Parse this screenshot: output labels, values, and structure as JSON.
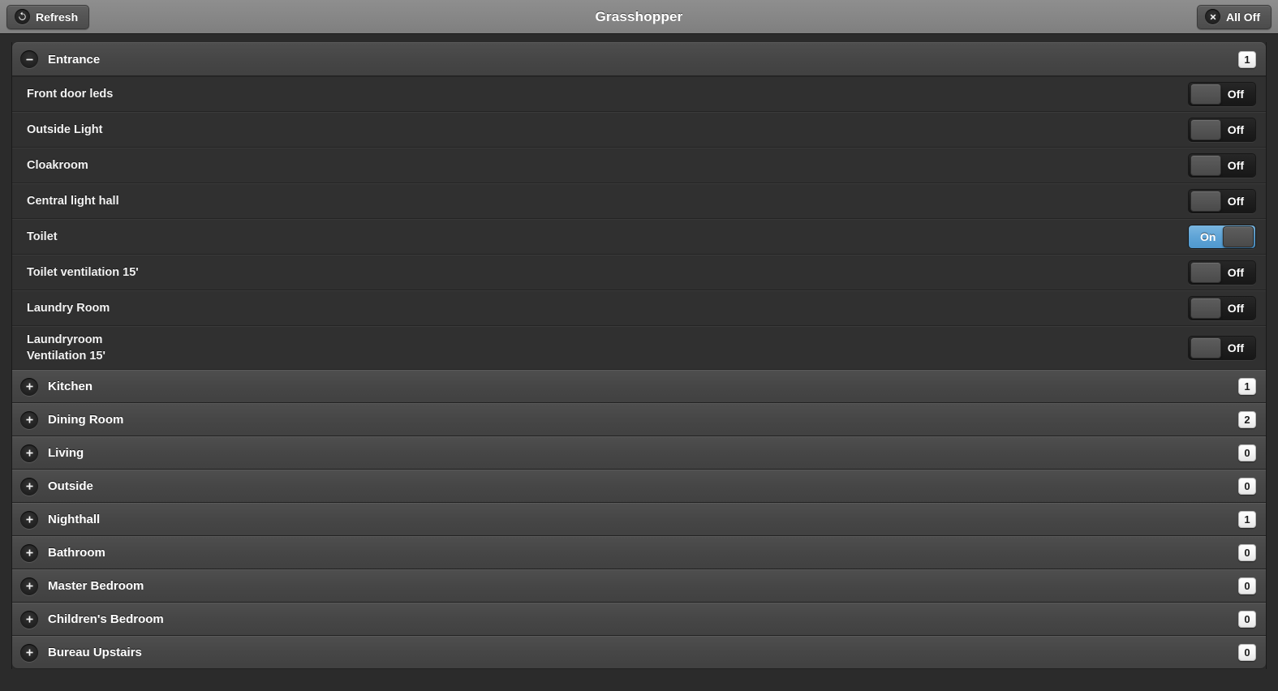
{
  "header": {
    "title": "Grasshopper",
    "refresh_label": "Refresh",
    "refresh_icon": "refresh-icon",
    "all_off_label": "All Off",
    "all_off_icon": "close-x-icon"
  },
  "colors": {
    "accent_on": "#5fa4d6",
    "topbar": "#878787",
    "group_header": "#464646",
    "row_bg": "#303030",
    "page_bg": "#2b2b2b"
  },
  "toggle_labels": {
    "on": "On",
    "off": "Off"
  },
  "groups": [
    {
      "name": "Entrance",
      "count": "1",
      "expanded": true,
      "icon": "minus-circle-icon",
      "devices": [
        {
          "label": "Front door leds",
          "state": "Off",
          "on": false
        },
        {
          "label": "Outside Light",
          "state": "Off",
          "on": false
        },
        {
          "label": "Cloakroom",
          "state": "Off",
          "on": false
        },
        {
          "label": "Central light hall",
          "state": "Off",
          "on": false
        },
        {
          "label": "Toilet",
          "state": "On",
          "on": true
        },
        {
          "label": "Toilet ventilation 15'",
          "state": "Off",
          "on": false
        },
        {
          "label": "Laundry Room",
          "state": "Off",
          "on": false
        },
        {
          "label": "Laundryroom\nVentilation 15'",
          "state": "Off",
          "on": false
        }
      ]
    },
    {
      "name": "Kitchen",
      "count": "1",
      "expanded": false,
      "icon": "plus-circle-icon",
      "devices": []
    },
    {
      "name": "Dining Room",
      "count": "2",
      "expanded": false,
      "icon": "plus-circle-icon",
      "devices": []
    },
    {
      "name": "Living",
      "count": "0",
      "expanded": false,
      "icon": "plus-circle-icon",
      "devices": []
    },
    {
      "name": "Outside",
      "count": "0",
      "expanded": false,
      "icon": "plus-circle-icon",
      "devices": []
    },
    {
      "name": "Nighthall",
      "count": "1",
      "expanded": false,
      "icon": "plus-circle-icon",
      "devices": []
    },
    {
      "name": "Bathroom",
      "count": "0",
      "expanded": false,
      "icon": "plus-circle-icon",
      "devices": []
    },
    {
      "name": "Master Bedroom",
      "count": "0",
      "expanded": false,
      "icon": "plus-circle-icon",
      "devices": []
    },
    {
      "name": "Children's Bedroom",
      "count": "0",
      "expanded": false,
      "icon": "plus-circle-icon",
      "devices": []
    },
    {
      "name": "Bureau Upstairs",
      "count": "0",
      "expanded": false,
      "icon": "plus-circle-icon",
      "devices": []
    }
  ]
}
